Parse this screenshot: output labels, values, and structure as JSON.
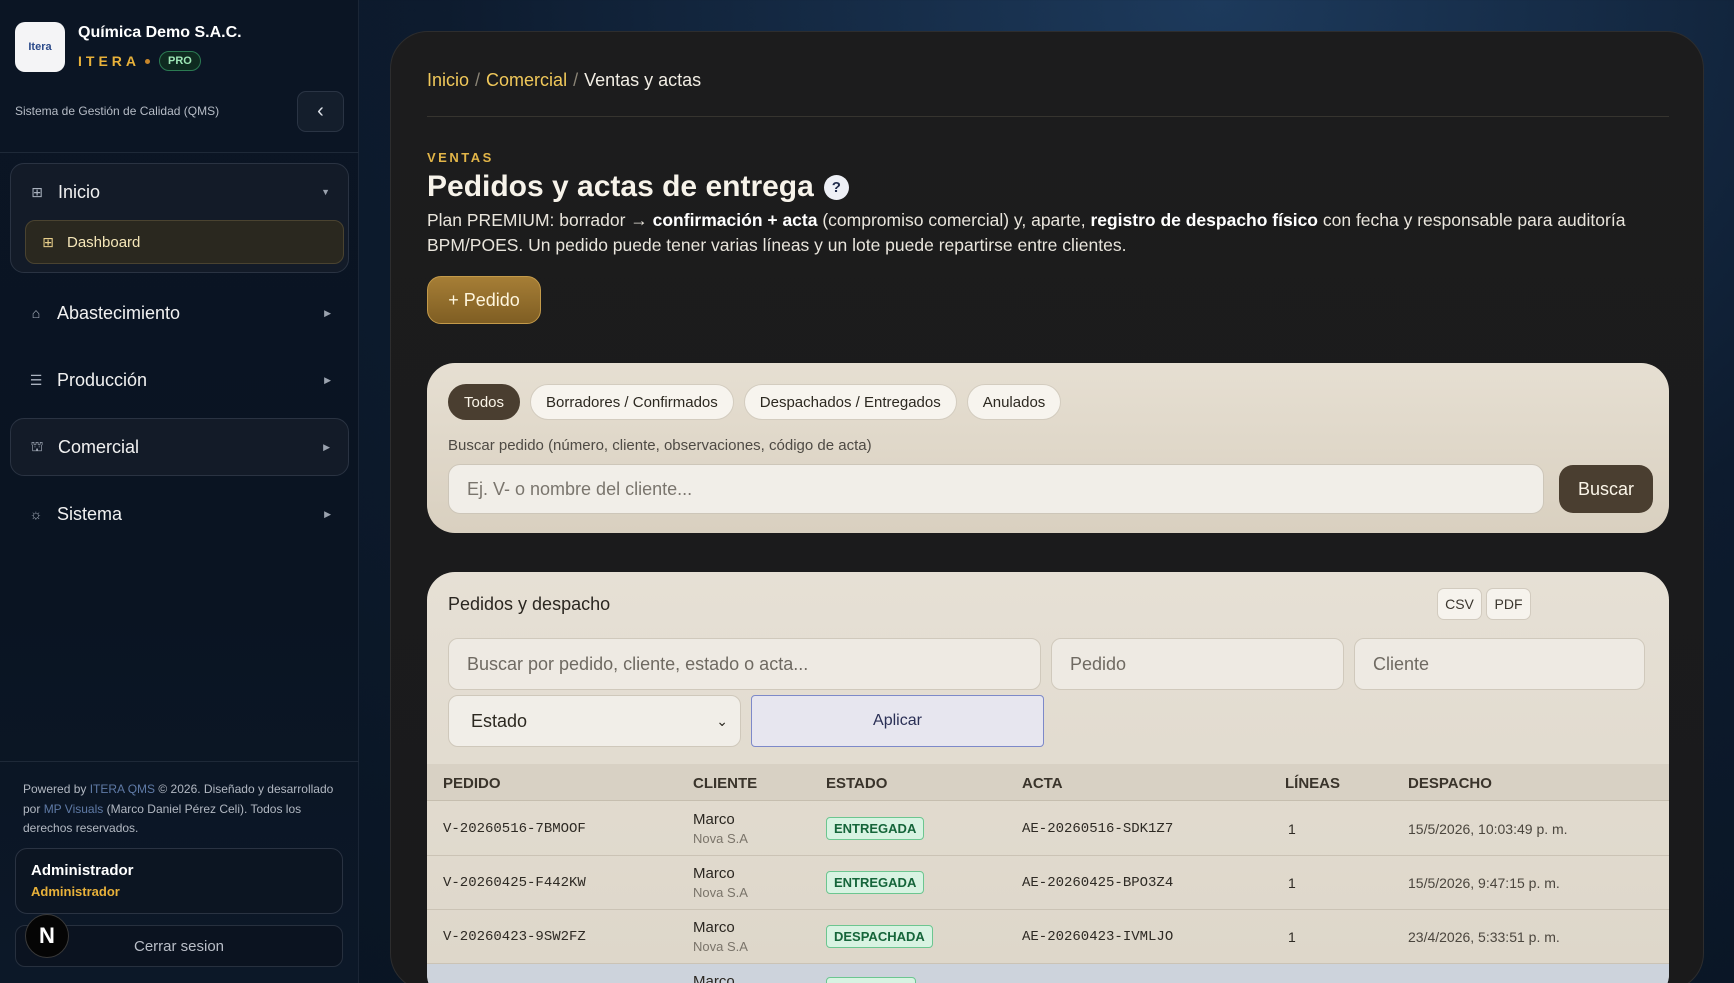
{
  "brand": {
    "logo_text": "Itera",
    "company": "Química Demo S.A.C.",
    "product": "ITERA",
    "tier": "PRO",
    "system": "Sistema de Gestión de Calidad (QMS)"
  },
  "sidebar": {
    "groups": [
      {
        "label": "Inicio",
        "icon": "grid-icon",
        "expanded": true,
        "sub": [
          {
            "label": "Dashboard",
            "icon": "grid-icon"
          }
        ]
      },
      {
        "label": "Abastecimiento",
        "icon": "warehouse-icon"
      },
      {
        "label": "Producción",
        "icon": "production-icon"
      },
      {
        "label": "Comercial",
        "icon": "store-icon",
        "active": true
      },
      {
        "label": "Sistema",
        "icon": "gear-icon"
      }
    ],
    "footer": {
      "powered_prefix": "Powered by ",
      "powered_link": "ITERA QMS",
      "powered_mid": " © 2026. Diseñado y desarrollado por ",
      "dev_link": "MP Visuals",
      "powered_suffix": " (Marco Daniel Pérez Celi). Todos los derechos reservados."
    },
    "user": {
      "name": "Administrador",
      "role": "Administrador"
    },
    "logout_label": "Cerrar sesion"
  },
  "breadcrumb": {
    "home": "Inicio",
    "section": "Comercial",
    "current": "Ventas y actas"
  },
  "page": {
    "eyebrow": "VENTAS",
    "title": "Pedidos y actas de entrega",
    "help": "?",
    "desc_1": "Plan PREMIUM: borrador → ",
    "desc_b1": "confirmación + acta",
    "desc_2": " (compromiso comercial) y, aparte, ",
    "desc_b2": "registro de despacho físico",
    "desc_3": " con fecha y responsable para auditoría BPM/POES. Un pedido puede tener varias líneas y un lote puede repartirse entre clientes.",
    "add_button": "+ Pedido"
  },
  "filters": {
    "tabs": [
      "Todos",
      "Borradores / Confirmados",
      "Despachados / Entregados",
      "Anulados"
    ],
    "active_tab": "Todos",
    "search_label": "Buscar pedido (número, cliente, observaciones, código de acta)",
    "search_placeholder": "Ej. V- o nombre del cliente...",
    "search_button": "Buscar"
  },
  "table": {
    "title": "Pedidos y despacho",
    "export_csv": "CSV",
    "export_pdf": "PDF",
    "filter_search_placeholder": "Buscar por pedido, cliente, estado o acta...",
    "filter_order_placeholder": "Pedido",
    "filter_client_placeholder": "Cliente",
    "filter_status": "Estado",
    "apply": "Aplicar",
    "columns": [
      "PEDIDO",
      "CLIENTE",
      "ESTADO",
      "ACTA",
      "LÍNEAS",
      "DESPACHO"
    ],
    "rows": [
      {
        "order": "V-20260516-7BMOOF",
        "client": "Marco",
        "company": "Nova S.A",
        "status": "ENTREGADA",
        "acta": "AE-20260516-SDK1Z7",
        "lines": "1",
        "dispatch": "15/5/2026, 10:03:49 p. m."
      },
      {
        "order": "V-20260425-F442KW",
        "client": "Marco",
        "company": "Nova S.A",
        "status": "ENTREGADA",
        "acta": "AE-20260425-BPO3Z4",
        "lines": "1",
        "dispatch": "15/5/2026, 9:47:15 p. m."
      },
      {
        "order": "V-20260423-9SW2FZ",
        "client": "Marco",
        "company": "Nova S.A",
        "status": "DESPACHADA",
        "acta": "AE-20260423-IVMLJO",
        "lines": "1",
        "dispatch": "23/4/2026, 5:33:51 p. m."
      },
      {
        "order": "",
        "client": "Marco",
        "company": "",
        "status": "",
        "acta": "",
        "lines": "",
        "dispatch": ""
      }
    ]
  },
  "colors": {
    "accent": "#e8b13a",
    "brown": "#4a3e30",
    "success_bg": "#d8f3e2",
    "success_text": "#15653a"
  }
}
